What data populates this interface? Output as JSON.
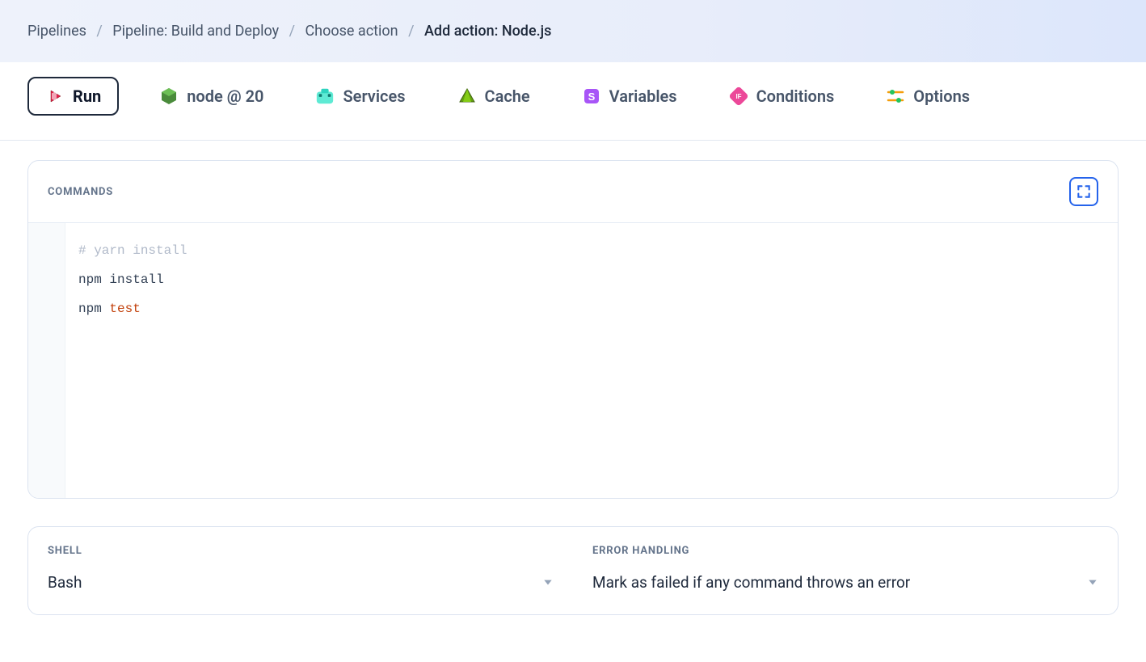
{
  "breadcrumbs": {
    "items": [
      {
        "label": "Pipelines"
      },
      {
        "label": "Pipeline: Build and Deploy"
      },
      {
        "label": "Choose action"
      }
    ],
    "current": "Add action: Node.js"
  },
  "tabs": {
    "run": "Run",
    "node": "node @ 20",
    "services": "Services",
    "cache": "Cache",
    "variables": "Variables",
    "conditions": "Conditions",
    "options": "Options"
  },
  "commands_panel": {
    "header": "COMMANDS",
    "lines": {
      "l1": "# yarn install",
      "l2_cmd": "npm install",
      "l3_cmd": "npm ",
      "l3_kw": "test"
    }
  },
  "shell_panel": {
    "label": "SHELL",
    "value": "Bash"
  },
  "error_panel": {
    "label": "ERROR HANDLING",
    "value": "Mark as failed if any command throws an error"
  }
}
